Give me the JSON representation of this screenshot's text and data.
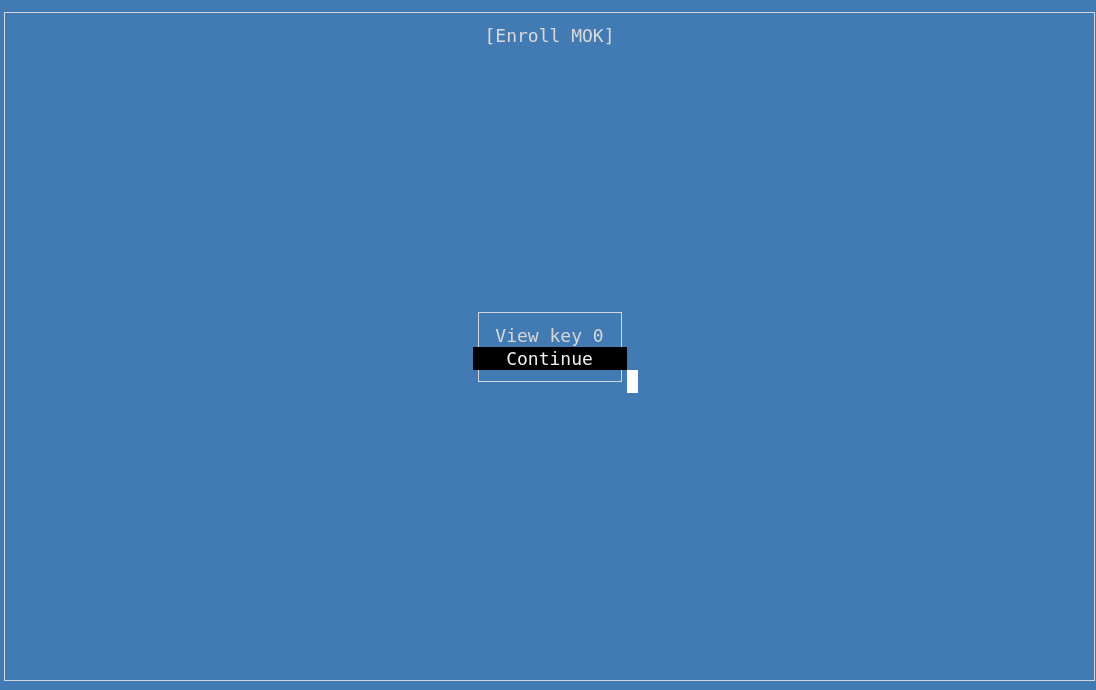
{
  "window": {
    "title": "[Enroll MOK]"
  },
  "menu": {
    "items": [
      {
        "label": "View key 0",
        "selected": false
      },
      {
        "label": "Continue",
        "selected": true
      }
    ]
  }
}
